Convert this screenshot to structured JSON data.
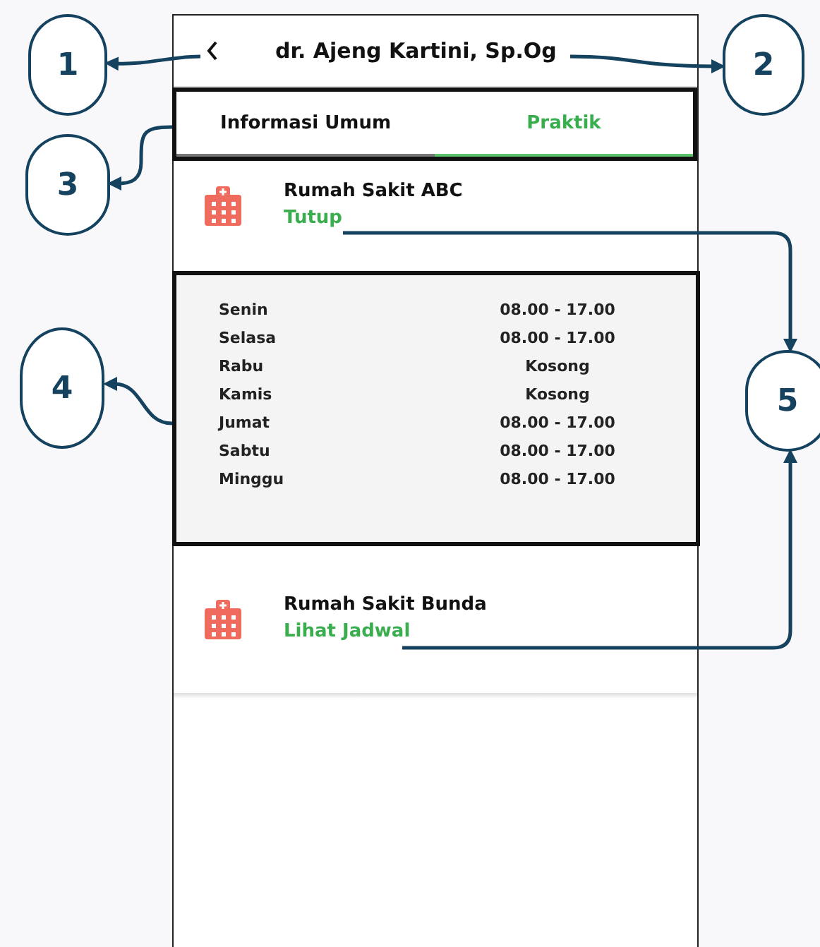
{
  "header": {
    "title": "dr. Ajeng Kartini, Sp.Og"
  },
  "tabs": [
    {
      "label": "Informasi Umum",
      "selected": false
    },
    {
      "label": "Praktik",
      "selected": true
    }
  ],
  "hospitals": [
    {
      "name": "Rumah Sakit ABC",
      "link": "Tutup",
      "schedule": [
        {
          "day": "Senin",
          "hours": "08.00 - 17.00"
        },
        {
          "day": "Selasa",
          "hours": "08.00 - 17.00"
        },
        {
          "day": "Rabu",
          "hours": "Kosong"
        },
        {
          "day": "Kamis",
          "hours": "Kosong"
        },
        {
          "day": "Jumat",
          "hours": "08.00 - 17.00"
        },
        {
          "day": "Sabtu",
          "hours": "08.00 - 17.00"
        },
        {
          "day": "Minggu",
          "hours": "08.00 - 17.00"
        }
      ]
    },
    {
      "name": "Rumah Sakit Bunda",
      "link": "Lihat Jadwal"
    }
  ],
  "callouts": [
    "1",
    "2",
    "3",
    "4",
    "5"
  ]
}
